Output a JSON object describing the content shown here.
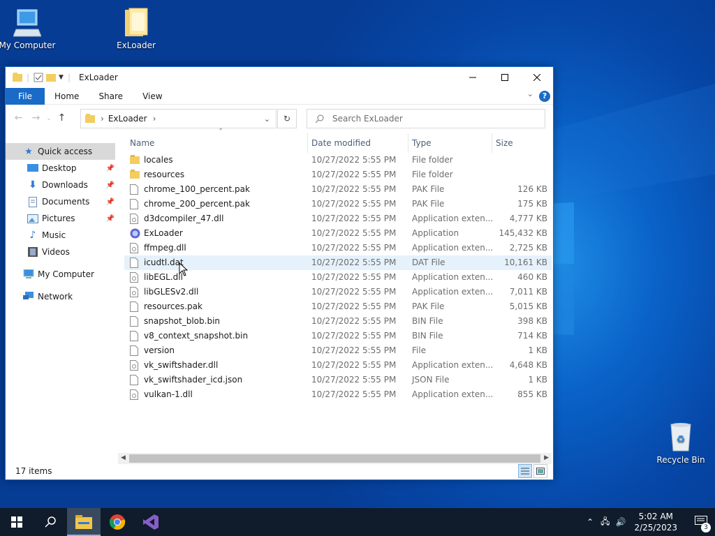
{
  "desktop": {
    "icons": [
      {
        "label": "My Computer",
        "icon": "computer-icon"
      },
      {
        "label": "ExLoader",
        "icon": "folder-icon"
      },
      {
        "label": "Recycle Bin",
        "icon": "recycle-bin-icon"
      }
    ]
  },
  "window": {
    "title": "ExLoader",
    "ribbon_tabs": [
      "File",
      "Home",
      "Share",
      "View"
    ],
    "address": {
      "crumb": "ExLoader"
    },
    "search": {
      "placeholder": "Search ExLoader"
    },
    "sidebar": [
      {
        "label": "Quick access",
        "icon": "star-icon",
        "selected": true
      },
      {
        "label": "Desktop",
        "icon": "desktop-icon",
        "pinned": true
      },
      {
        "label": "Downloads",
        "icon": "download-icon",
        "pinned": true
      },
      {
        "label": "Documents",
        "icon": "document-icon",
        "pinned": true
      },
      {
        "label": "Pictures",
        "icon": "pictures-icon",
        "pinned": true
      },
      {
        "label": "Music",
        "icon": "music-icon"
      },
      {
        "label": "Videos",
        "icon": "videos-icon"
      },
      {
        "label": "My Computer",
        "icon": "computer-icon"
      },
      {
        "label": "Network",
        "icon": "network-icon"
      }
    ],
    "columns": {
      "name": "Name",
      "date": "Date modified",
      "type": "Type",
      "size": "Size"
    },
    "files": [
      {
        "name": "locales",
        "date": "10/27/2022 5:55 PM",
        "type": "File folder",
        "size": "",
        "icon": "folder-icon"
      },
      {
        "name": "resources",
        "date": "10/27/2022 5:55 PM",
        "type": "File folder",
        "size": "",
        "icon": "folder-icon"
      },
      {
        "name": "chrome_100_percent.pak",
        "date": "10/27/2022 5:55 PM",
        "type": "PAK File",
        "size": "126 KB",
        "icon": "file-icon"
      },
      {
        "name": "chrome_200_percent.pak",
        "date": "10/27/2022 5:55 PM",
        "type": "PAK File",
        "size": "175 KB",
        "icon": "file-icon"
      },
      {
        "name": "d3dcompiler_47.dll",
        "date": "10/27/2022 5:55 PM",
        "type": "Application exten...",
        "size": "4,777 KB",
        "icon": "dll-icon"
      },
      {
        "name": "ExLoader",
        "date": "10/27/2022 5:55 PM",
        "type": "Application",
        "size": "145,432 KB",
        "icon": "app-icon"
      },
      {
        "name": "ffmpeg.dll",
        "date": "10/27/2022 5:55 PM",
        "type": "Application exten...",
        "size": "2,725 KB",
        "icon": "dll-icon"
      },
      {
        "name": "icudtl.dat",
        "date": "10/27/2022 5:55 PM",
        "type": "DAT File",
        "size": "10,161 KB",
        "icon": "file-icon"
      },
      {
        "name": "libEGL.dll",
        "date": "10/27/2022 5:55 PM",
        "type": "Application exten...",
        "size": "460 KB",
        "icon": "dll-icon"
      },
      {
        "name": "libGLESv2.dll",
        "date": "10/27/2022 5:55 PM",
        "type": "Application exten...",
        "size": "7,011 KB",
        "icon": "dll-icon"
      },
      {
        "name": "resources.pak",
        "date": "10/27/2022 5:55 PM",
        "type": "PAK File",
        "size": "5,015 KB",
        "icon": "file-icon"
      },
      {
        "name": "snapshot_blob.bin",
        "date": "10/27/2022 5:55 PM",
        "type": "BIN File",
        "size": "398 KB",
        "icon": "file-icon"
      },
      {
        "name": "v8_context_snapshot.bin",
        "date": "10/27/2022 5:55 PM",
        "type": "BIN File",
        "size": "714 KB",
        "icon": "file-icon"
      },
      {
        "name": "version",
        "date": "10/27/2022 5:55 PM",
        "type": "File",
        "size": "1 KB",
        "icon": "file-icon"
      },
      {
        "name": "vk_swiftshader.dll",
        "date": "10/27/2022 5:55 PM",
        "type": "Application exten...",
        "size": "4,648 KB",
        "icon": "dll-icon"
      },
      {
        "name": "vk_swiftshader_icd.json",
        "date": "10/27/2022 5:55 PM",
        "type": "JSON File",
        "size": "1 KB",
        "icon": "file-icon"
      },
      {
        "name": "vulkan-1.dll",
        "date": "10/27/2022 5:55 PM",
        "type": "Application exten...",
        "size": "855 KB",
        "icon": "dll-icon"
      }
    ],
    "status": "17 items"
  },
  "taskbar": {
    "time": "5:02 AM",
    "date": "2/25/2023",
    "notifications": "3"
  },
  "colors": {
    "accent": "#1a6bc7",
    "desktop": "#0a5cc2",
    "taskbar": "#101b2b"
  }
}
